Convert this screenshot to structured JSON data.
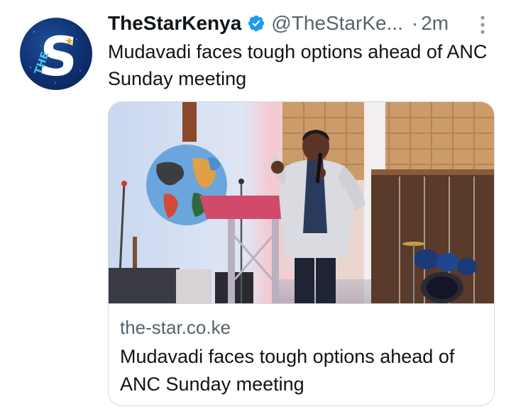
{
  "tweet": {
    "display_name": "TheStarKenya",
    "handle": "@TheStarKe...",
    "separator": "·",
    "time": "2m",
    "text": "Mudavadi faces tough options ahead of ANC Sunday meeting",
    "verified_icon": "verified-badge-icon",
    "more_icon": "more-vertical-icon"
  },
  "avatar": {
    "letter": "S",
    "tag": "THE",
    "brand_colors": {
      "background": "#0e2f6e",
      "letter": "#ffffff",
      "tag": "#46c3ee",
      "star": "#f0a624"
    }
  },
  "card": {
    "domain": "the-star.co.ke",
    "title": "Mudavadi faces tough options ahead of ANC Sunday meeting"
  },
  "colors": {
    "text_primary": "#0f1419",
    "text_secondary": "#536471",
    "verified": "#1d9bf0",
    "border": "#cfd9de"
  }
}
